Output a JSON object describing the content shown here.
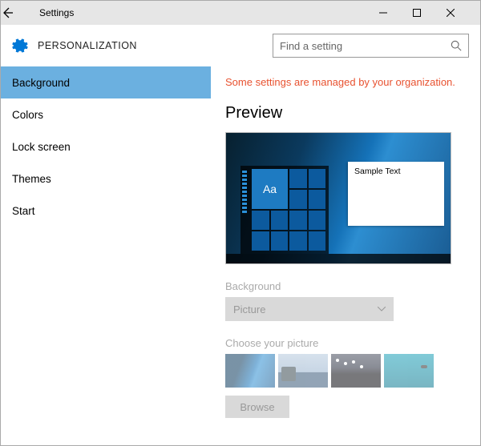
{
  "window": {
    "title": "Settings"
  },
  "header": {
    "section": "PERSONALIZATION",
    "search_placeholder": "Find a setting"
  },
  "sidebar": {
    "items": [
      {
        "label": "Background",
        "active": true
      },
      {
        "label": "Colors",
        "active": false
      },
      {
        "label": "Lock screen",
        "active": false
      },
      {
        "label": "Themes",
        "active": false
      },
      {
        "label": "Start",
        "active": false
      }
    ]
  },
  "main": {
    "warning": "Some settings are managed by your organization.",
    "preview_heading": "Preview",
    "preview_window_text": "Sample Text",
    "preview_tile_text": "Aa",
    "background_label": "Background",
    "background_value": "Picture",
    "choose_label": "Choose your picture",
    "browse_label": "Browse"
  },
  "annotation": {
    "arrow_color": "#ff0000"
  }
}
